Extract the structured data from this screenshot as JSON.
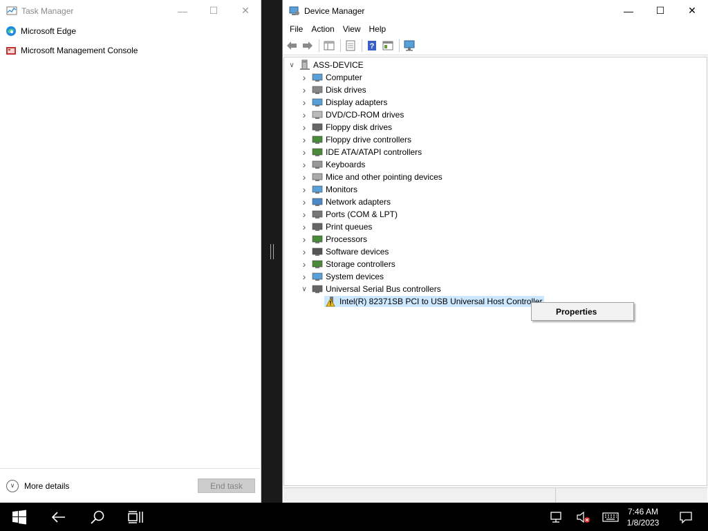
{
  "task_manager": {
    "title": "Task Manager",
    "apps": [
      {
        "label": "Microsoft Edge",
        "icon": "edge-icon"
      },
      {
        "label": "Microsoft Management Console",
        "icon": "mmc-icon"
      }
    ],
    "more_details": "More details",
    "end_task": "End task"
  },
  "device_manager": {
    "title": "Device Manager",
    "menu": [
      "File",
      "Action",
      "View",
      "Help"
    ],
    "root": "ASS-DEVICE",
    "categories": [
      {
        "label": "Computer",
        "icon": "computer-icon"
      },
      {
        "label": "Disk drives",
        "icon": "disk-drive-icon"
      },
      {
        "label": "Display adapters",
        "icon": "display-adapter-icon"
      },
      {
        "label": "DVD/CD-ROM drives",
        "icon": "dvd-icon"
      },
      {
        "label": "Floppy disk drives",
        "icon": "floppy-disk-icon"
      },
      {
        "label": "Floppy drive controllers",
        "icon": "floppy-controller-icon"
      },
      {
        "label": "IDE ATA/ATAPI controllers",
        "icon": "ide-controller-icon"
      },
      {
        "label": "Keyboards",
        "icon": "keyboard-icon"
      },
      {
        "label": "Mice and other pointing devices",
        "icon": "mouse-icon"
      },
      {
        "label": "Monitors",
        "icon": "monitor-icon"
      },
      {
        "label": "Network adapters",
        "icon": "network-adapter-icon"
      },
      {
        "label": "Ports (COM & LPT)",
        "icon": "port-icon"
      },
      {
        "label": "Print queues",
        "icon": "printer-icon"
      },
      {
        "label": "Processors",
        "icon": "processor-icon"
      },
      {
        "label": "Software devices",
        "icon": "software-device-icon"
      },
      {
        "label": "Storage controllers",
        "icon": "storage-controller-icon"
      },
      {
        "label": "System devices",
        "icon": "system-device-icon"
      },
      {
        "label": "Universal Serial Bus controllers",
        "icon": "usb-icon"
      }
    ],
    "usb_child": "Intel(R) 82371SB PCI to USB Universal Host Controller",
    "context_menu": [
      "Properties"
    ]
  },
  "taskbar": {
    "time": "7:46 AM",
    "date": "1/8/2023"
  }
}
